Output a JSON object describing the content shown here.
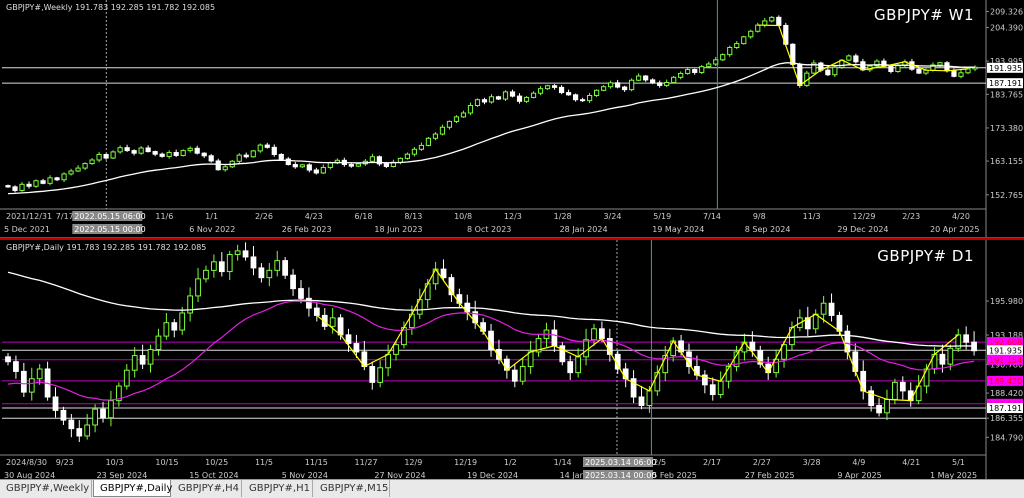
{
  "tabs": [
    "GBPJPY#,Weekly",
    "GBPJPY#,Daily",
    "GBPJPY#,H4",
    "GBPJPY#,H1",
    "GBPJPY#,M15"
  ],
  "active_tab": 1,
  "chart_data": [
    {
      "type": "candlestick",
      "title": "GBPJPY# W1",
      "header": "GBPJPY#,Weekly  191.783 192.285 191.782 192.085",
      "ylim": [
        149.0,
        211.0
      ],
      "y_ticks": [
        "209.326",
        "204.390",
        "193.995",
        "183.765",
        "173.380",
        "163.155",
        "152.765"
      ],
      "price_labels": [
        {
          "text": "191.935",
          "value": 191.935,
          "color": "#ffffff"
        },
        {
          "text": "187.191",
          "value": 187.191,
          "color": "#ffffff"
        }
      ],
      "h_lines": [
        191.935,
        187.191
      ],
      "v_lines": [
        {
          "x_frac": 0.727,
          "color": "#2aa6a6"
        }
      ],
      "crosshair_x_frac": 0.106,
      "x_ticks": [
        "2021/12/31",
        "7/17",
        "9/11",
        "11/6",
        "1/1",
        "2/26",
        "4/23",
        "6/18",
        "8/13",
        "10/8",
        "12/3",
        "1/28",
        "3/24",
        "5/19",
        "7/14",
        "9/8",
        "11/3",
        "12/29",
        "2/23",
        "4/20"
      ],
      "x_dates": [
        "5 Dec 2021",
        "17 Jul 2022",
        "6 Nov 2022",
        "26 Feb 2023",
        "18 Jun 2023",
        "8 Oct 2023",
        "28 Jan 2024",
        "19 May 2024",
        "8 Sep 2024",
        "29 Dec 2024",
        "20 Apr 2025"
      ],
      "crosshair_label": "2022.05.15 06:00",
      "crosshair_label2": "2022.05.15 00:00",
      "series_close": [
        155.2,
        154.1,
        156.0,
        155.4,
        157.1,
        156.3,
        158.0,
        157.4,
        159.2,
        160.1,
        161.0,
        162.4,
        163.5,
        165.2,
        164.1,
        166.0,
        167.3,
        166.4,
        165.6,
        167.2,
        166.1,
        165.3,
        164.6,
        165.8,
        164.9,
        166.4,
        167.1,
        165.6,
        164.8,
        163.2,
        160.5,
        161.4,
        163.1,
        165.0,
        164.5,
        166.3,
        168.1,
        167.4,
        165.2,
        163.8,
        162.1,
        161.4,
        162.0,
        160.4,
        159.5,
        161.2,
        162.6,
        163.4,
        162.1,
        161.6,
        162.3,
        163.1,
        164.5,
        162.3,
        161.5,
        162.8,
        164.0,
        165.3,
        166.8,
        168.0,
        170.2,
        171.5,
        173.6,
        175.4,
        176.8,
        178.0,
        180.3,
        182.1,
        181.4,
        183.0,
        182.3,
        184.5,
        183.2,
        181.6,
        182.8,
        184.1,
        185.5,
        186.4,
        185.9,
        184.3,
        183.6,
        182.1,
        181.8,
        183.4,
        185.0,
        186.1,
        187.3,
        186.0,
        185.2,
        188.1,
        189.4,
        188.2,
        187.3,
        186.5,
        187.4,
        189.0,
        190.2,
        191.4,
        190.5,
        192.3,
        193.1,
        194.4,
        196.0,
        198.2,
        199.4,
        201.5,
        203.2,
        205.1,
        206.4,
        207.5,
        205.0,
        199.2,
        193.0,
        186.5,
        190.3,
        193.4,
        191.2,
        189.8,
        192.1,
        194.3,
        195.6,
        193.8,
        191.3,
        192.5,
        194.0,
        192.4,
        190.8,
        192.6,
        193.8,
        191.5,
        190.3,
        191.2,
        192.8,
        193.5,
        191.0,
        189.3,
        190.4,
        191.6,
        192.1
      ],
      "series_ma_start": 153.0
    },
    {
      "type": "candlestick",
      "title": "GBPJPY# D1",
      "header": "GBPJPY#,Daily  191.783 192.285 191.782 192.085",
      "ylim": [
        183.5,
        200.5
      ],
      "y_ticks": [
        "195.980",
        "193.188",
        "190.780",
        "188.420",
        "186.355",
        "184.790"
      ],
      "price_labels": [
        {
          "text": "192.608",
          "value": 192.608,
          "color": "#ff00ff"
        },
        {
          "text": "191.935",
          "value": 191.935,
          "color": "#ffffff"
        },
        {
          "text": "191.154",
          "value": 191.154,
          "color": "#ff00ff"
        },
        {
          "text": "189.420",
          "value": 189.42,
          "color": "#ff00ff"
        },
        {
          "text": "187.541",
          "value": 187.541,
          "color": "#ff00ff"
        },
        {
          "text": "187.191",
          "value": 187.191,
          "color": "#ffffff"
        }
      ],
      "h_lines": [
        192.608,
        191.935,
        191.154,
        189.42,
        187.541,
        187.191,
        186.355
      ],
      "v_lines": [
        {
          "x_frac": 0.66,
          "color": "#2aa6a6"
        }
      ],
      "crosshair_x_frac": 0.625,
      "x_ticks": [
        "2024/8/30",
        "9/23",
        "10/3",
        "10/15",
        "10/25",
        "11/5",
        "11/15",
        "11/27",
        "12/9",
        "12/19",
        "1/2",
        "1/14",
        "1/24",
        "2/5",
        "2/17",
        "2/27",
        "3/28",
        "4/9",
        "4/21",
        "5/1"
      ],
      "x_dates": [
        "30 Aug 2024",
        "23 Sep 2024",
        "15 Oct 2024",
        "5 Nov 2024",
        "27 Nov 2024",
        "19 Dec 2024",
        "14 Jan 2025",
        "5 Feb 2025",
        "27 Feb 2025",
        "9 Apr 2025",
        "1 May 2025"
      ],
      "crosshair_label": "2025.03.14 06:00",
      "crosshair_label2": "2025.03.14 00:00",
      "series_close": [
        191.0,
        190.2,
        188.5,
        189.6,
        190.4,
        188.1,
        187.0,
        186.2,
        185.5,
        184.9,
        185.8,
        187.1,
        186.4,
        187.8,
        189.0,
        190.3,
        191.5,
        190.8,
        192.0,
        193.1,
        194.2,
        193.6,
        195.0,
        196.4,
        197.8,
        198.5,
        199.2,
        198.4,
        199.8,
        200.1,
        199.6,
        198.7,
        197.9,
        198.5,
        199.3,
        198.1,
        197.0,
        196.2,
        195.4,
        194.8,
        193.9,
        194.6,
        193.2,
        192.5,
        191.8,
        190.6,
        189.3,
        190.5,
        191.6,
        192.4,
        193.8,
        194.9,
        196.1,
        197.4,
        198.6,
        197.9,
        196.5,
        195.8,
        195.1,
        194.2,
        193.5,
        192.0,
        191.2,
        190.3,
        189.4,
        190.6,
        191.8,
        192.9,
        193.6,
        192.3,
        191.0,
        190.1,
        191.4,
        192.8,
        193.7,
        192.9,
        191.6,
        190.4,
        189.6,
        188.1,
        187.4,
        188.6,
        190.1,
        191.5,
        192.7,
        191.8,
        190.6,
        189.9,
        189.1,
        188.3,
        189.4,
        190.6,
        191.8,
        192.6,
        191.9,
        190.8,
        190.1,
        191.2,
        192.4,
        193.8,
        194.6,
        193.7,
        194.9,
        195.8,
        194.8,
        193.5,
        191.8,
        190.2,
        188.6,
        187.4,
        186.8,
        187.9,
        189.3,
        188.6,
        187.8,
        189.0,
        190.4,
        191.6,
        190.8,
        192.1,
        193.2,
        192.6,
        191.9
      ],
      "series_ma_start": 198.5
    }
  ]
}
